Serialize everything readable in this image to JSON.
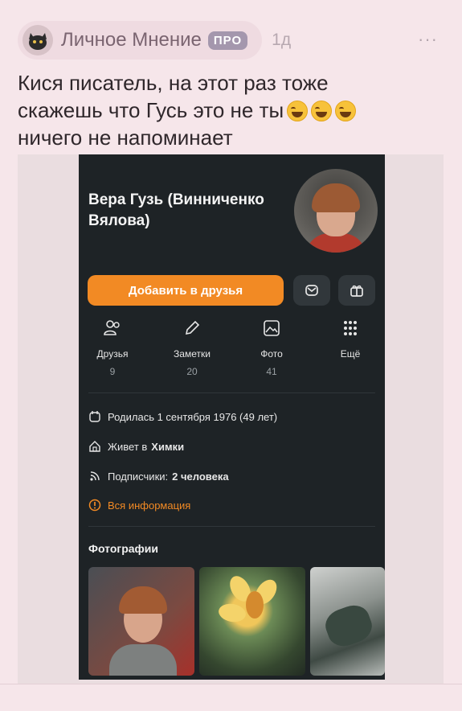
{
  "post": {
    "author": "Личное Мнение",
    "badge": "ПРО",
    "time": "1д",
    "more": "···",
    "text_line1": "Кися писатель, на этот раз тоже",
    "text_line2": "скажешь что Гусь это не ты",
    "text_line3": "ничего не напоминает",
    "emojis": [
      "rolling-on-floor-laughing",
      "rolling-on-floor-laughing",
      "rolling-on-floor-laughing"
    ]
  },
  "profile": {
    "name": "Вера Гузь (Винниченко Вялова)",
    "add_friend_label": "Добавить в друзья",
    "stats": [
      {
        "label": "Друзья",
        "count": "9",
        "icon": "friends-icon"
      },
      {
        "label": "Заметки",
        "count": "20",
        "icon": "pencil-icon"
      },
      {
        "label": "Фото",
        "count": "41",
        "icon": "photo-icon"
      },
      {
        "label": "Ещё",
        "count": "",
        "icon": "grid-icon"
      }
    ],
    "birthday": "Родилась 1 сентября 1976 (49 лет)",
    "lives_prefix": "Живет в",
    "lives_city": "Химки",
    "followers_prefix": "Подписчики:",
    "followers_value": "2 человека",
    "all_info": "Вся информация",
    "photos_title": "Фотографии"
  },
  "colors": {
    "background": "#f6e6ea",
    "accent_orange": "#f28a24",
    "profile_bg": "#1e2326",
    "badge": "#a497ad"
  }
}
